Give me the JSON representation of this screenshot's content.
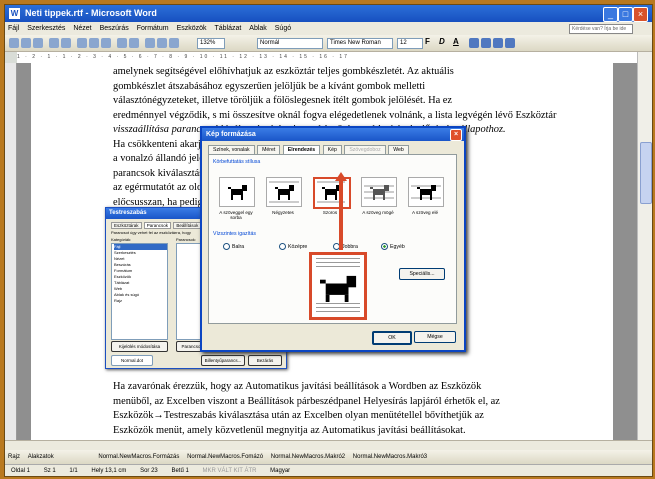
{
  "window": {
    "title": "Neti tippek.rtf - Microsoft Word",
    "min": "_",
    "max": "□",
    "close": "×"
  },
  "menu": [
    "Fájl",
    "Szerkesztés",
    "Nézet",
    "Beszúrás",
    "Formátum",
    "Eszközök",
    "Táblázat",
    "Ablak",
    "Súgó"
  ],
  "help_placeholder": "Kérdése van? Írja be ide",
  "toolbar": {
    "zoom": "132%",
    "style": "Normál",
    "font": "Times New Roman",
    "size": "12",
    "bold": "F",
    "italic": "D",
    "underline": "A"
  },
  "ruler_text": "1 · 2 · 1 · 1 · 2 · 3 · 4 · 5 · 6 · 7 · 8 · 9 · 10 · 11 · 12 · 13 · 14 · 15 · 16 · 17",
  "doc": {
    "para1_lines": [
      "amelynek segítségével előhívhatjuk az eszköztár teljes gombkészletét. Az aktuális",
      "gombkészlet átszabásához egyszerűen jelöljük be a kívánt gombok melletti",
      "választónégyzeteket, illetve töröljük a fölöslegesnek ítélt gombok jelölését. Ha ez",
      "eredménnyel végződik, s mi összesítve oknál fogva elégedetlenek volnánk, a lista legvégén lévő Eszköztár",
      "visszaállítása paranccsal kiválaszthatjuk, visszatérhetünk a módosítások előtti alapállapothoz.",
      "Ha csökkenteni akarjuk … semmi szükségünk",
      "a vonalzó állandó jelenlétére … → Vonalzó",
      "parancsok kiválasztása … volna rá, elég",
      "az egérmutatót az oldal … vonalzó azonnal",
      "előcsusszan, ha pedig …"
    ],
    "para2_lines": [
      "Ha zavarónak érezzük, hogy az Automatikus javítási beállítások a Wordben az Eszközök",
      "menüből, az Excelben viszont a Beállítások párbeszédpanel Helyesírás lapjáról érhetők el, az",
      "Eszközök→Testreszabás kiválasztása után az Excelben olyan menütétellel bővíthetjük az",
      "Eszközök menüt, amely közvetlenül megnyitja az Automatikus javítási beállításokat."
    ]
  },
  "dialog_main": {
    "title": "Kép formázása",
    "close": "×",
    "tabs": [
      "Színek, vonalak",
      "Méret",
      "Elrendezés",
      "Kép",
      "Szövegdoboz",
      "Web"
    ],
    "group_wrap": "Körbefuttatás stílusa",
    "wrap_options": [
      "A szöveggel egy sorba",
      "Négyzetes",
      "Szoros",
      "A szöveg mögé",
      "A szöveg elé"
    ],
    "group_align": "Vízszintes igazítás",
    "align_options": [
      "Balra",
      "Középre",
      "Jobbra",
      "Egyéb"
    ],
    "btn_special": "Speciális...",
    "btn_ok": "OK",
    "btn_cancel": "Mégse"
  },
  "dialog_small": {
    "title": "Testreszabás",
    "tabs": [
      "Eszköztárak",
      "Parancsok",
      "Beállítások"
    ],
    "hint": "Parancsot úgy vehet fel az eszköztárra, hogy",
    "cat_label": "Kategóriák:",
    "cmd_label": "Parancsok:",
    "categories": [
      "Fájl",
      "Szerkesztés",
      "Nézet",
      "Beszúrás",
      "Formátum",
      "Eszközök",
      "Táblázat",
      "Web",
      "Ablak és súgó",
      "Rajz"
    ],
    "btn_modify": "Kijelölés módosítása",
    "btn_rearrange": "Parancsok átrendezése...",
    "save_in": "Normal.dot",
    "btn_kbd": "Billentyűparancs...",
    "btn_close": "Bezárás"
  },
  "drawbar_items": [
    "Rajz",
    "Alakzatok",
    "Normal.NewMacros.Formázás",
    "Normal.NewMacros.Fomázó",
    "Normal.NewMacros.Makró2",
    "Normal.NewMacros.Makró3"
  ],
  "status": {
    "page": "Oldal 1",
    "section": "Sz 1",
    "pages": "1/1",
    "pos": "Hely 13,1 cm",
    "line": "Sor 23",
    "col": "Betű 1",
    "modes": "MKR  VÁLT  KIT  ÁTR",
    "lang": "Magyar"
  }
}
